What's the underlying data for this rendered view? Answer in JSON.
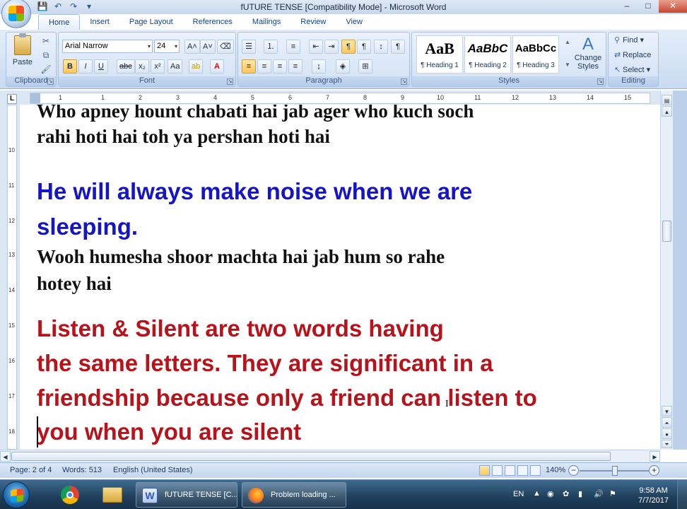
{
  "window": {
    "title": "fUTURE TENSE [Compatibility Mode] - Microsoft Word",
    "controls": {
      "minimize": "–",
      "maximize": "□",
      "close": "✕"
    }
  },
  "tabs": [
    {
      "label": "Home",
      "active": true
    },
    {
      "label": "Insert"
    },
    {
      "label": "Page Layout"
    },
    {
      "label": "References"
    },
    {
      "label": "Mailings"
    },
    {
      "label": "Review"
    },
    {
      "label": "View"
    }
  ],
  "ribbon": {
    "clipboard": {
      "label": "Clipboard",
      "paste": "Paste"
    },
    "font": {
      "label": "Font",
      "font_name": "Arial Narrow",
      "font_size": "24",
      "bold": "B",
      "italic": "I",
      "underline": "U",
      "strike": "abc",
      "sub": "x₂",
      "sup": "x²",
      "case": "Aa",
      "grow": "A",
      "shrink": "A"
    },
    "paragraph": {
      "label": "Paragraph"
    },
    "styles": {
      "label": "Styles",
      "items": [
        {
          "preview": "AaB",
          "name": "¶ Heading 1"
        },
        {
          "preview": "AaBbC",
          "name": "¶ Heading 2"
        },
        {
          "preview": "AaBbCc",
          "name": "¶ Heading 3"
        }
      ],
      "change_styles": "Change Styles"
    },
    "editing": {
      "label": "Editing",
      "find": "Find",
      "replace": "Replace",
      "select": "Select"
    }
  },
  "ruler": {
    "h_numbers": [
      "1",
      "1",
      "2",
      "3",
      "4",
      "5",
      "6",
      "7",
      "8",
      "9",
      "10",
      "11",
      "12",
      "13",
      "14",
      "15"
    ],
    "v_numbers": [
      "10",
      "11",
      "12",
      "13",
      "14",
      "15",
      "16",
      "17",
      "18"
    ]
  },
  "document": {
    "line1": "Who apney hount chabati hai jab ager who kuch soch",
    "line2": "rahi hoti hai toh ya  pershan hoti hai",
    "blue1": "He will always make noise when we are",
    "blue2": "sleeping.",
    "line3": "Wooh humesha shoor machta hai jab hum so rahe",
    "line4": "hotey hai",
    "red1": "Listen & Silent are two words having",
    "red2": "the same letters. They are significant in a",
    "red3": "friendship because only a friend can listen to",
    "red4": "you when you are silent"
  },
  "status": {
    "page": "Page: 2 of 4",
    "words": "Words: 513",
    "language": "English (United States)",
    "zoom": "140%"
  },
  "taskbar": {
    "tasks": [
      {
        "label": "fUTURE TENSE [C..."
      },
      {
        "label": "Problem loading ..."
      }
    ],
    "lang": "EN",
    "time": "9:58 AM",
    "date": "7/7/2017"
  }
}
